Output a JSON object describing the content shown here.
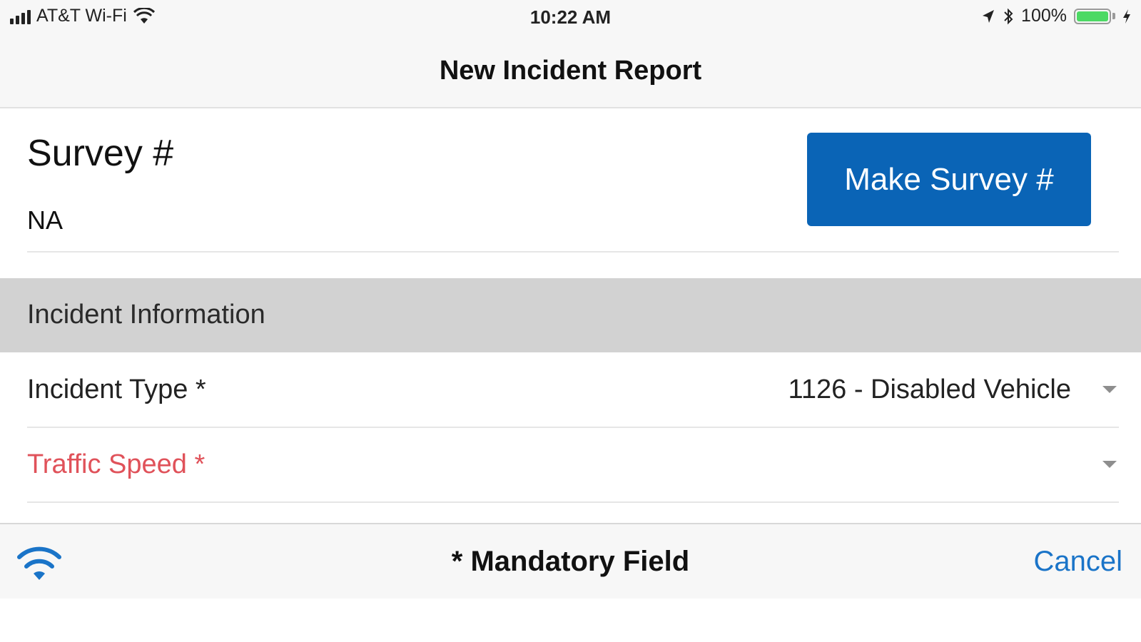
{
  "status_bar": {
    "carrier": "AT&T Wi-Fi",
    "time": "10:22 AM",
    "battery": "100%",
    "signal_bars": 4,
    "battery_color": "#4cd964"
  },
  "nav": {
    "title": "New Incident Report"
  },
  "survey": {
    "title": "Survey #",
    "value": "NA",
    "button_label": "Make Survey #"
  },
  "section": {
    "header": "Incident Information"
  },
  "fields": [
    {
      "label": "Incident Type *",
      "value": "1126 - Disabled Vehicle",
      "state": "filled"
    },
    {
      "label": "Traffic Speed *",
      "value": "",
      "state": "missing"
    }
  ],
  "toolbar": {
    "network_icon": "wifi-icon",
    "mandatory_note": "* Mandatory Field",
    "cancel_label": "Cancel"
  },
  "colors": {
    "accent": "#0a64b6",
    "link": "#1a74c8",
    "required": "#e0525a",
    "section_bg": "#d2d2d2"
  }
}
